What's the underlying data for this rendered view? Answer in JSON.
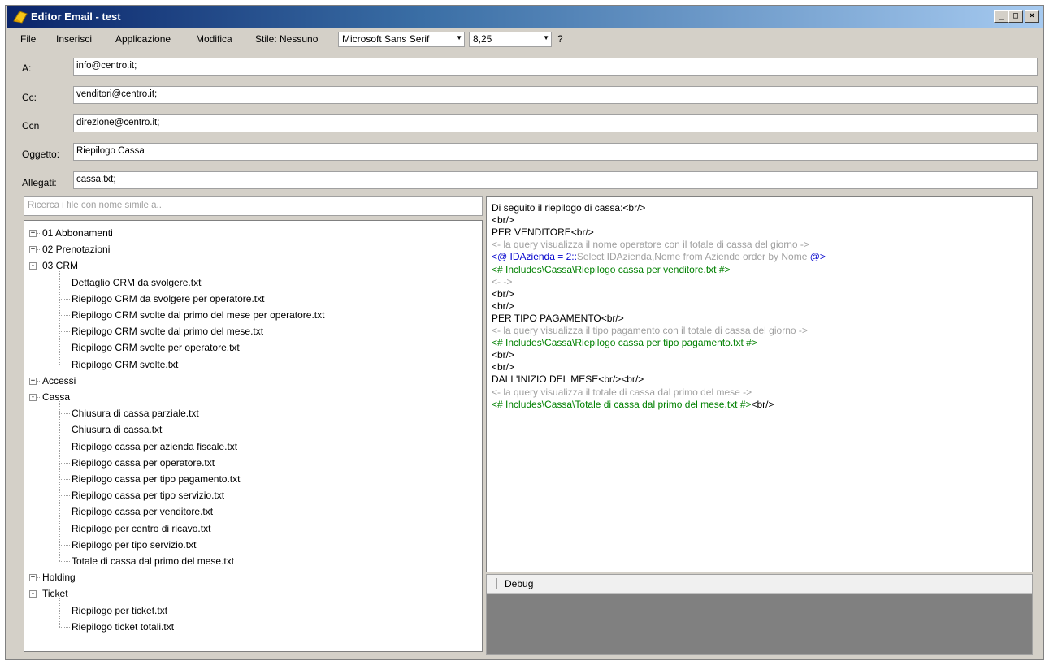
{
  "window": {
    "title": "Editor Email - test",
    "controls": {
      "minimize": "_",
      "maximize": "□",
      "close": "×"
    }
  },
  "menu": {
    "items": [
      "File",
      "Inserisci",
      "Applicazione",
      "Modifica",
      "Stile: Nessuno"
    ],
    "font_name": "Microsoft Sans Serif",
    "font_size": "8,25",
    "help": "?"
  },
  "fields": {
    "to": {
      "label": "A:",
      "value": "info@centro.it;"
    },
    "cc": {
      "label": "Cc:",
      "value": "venditori@centro.it;"
    },
    "bcc": {
      "label": "Ccn",
      "value": "direzione@centro.it;"
    },
    "subject": {
      "label": "Oggetto:",
      "value": "Riepilogo Cassa"
    },
    "attachments": {
      "label": "Allegati:",
      "value": "cassa.txt;"
    }
  },
  "search": {
    "placeholder": "Ricerca i file con nome simile a.."
  },
  "tree": {
    "nodes": [
      {
        "label": "01 Abbonamenti",
        "level": 0,
        "expander": "+"
      },
      {
        "label": "02 Prenotazioni",
        "level": 0,
        "expander": "+"
      },
      {
        "label": "03 CRM",
        "level": 0,
        "expander": "-"
      },
      {
        "label": "Dettaglio CRM da svolgere.txt",
        "level": 1
      },
      {
        "label": "Riepilogo CRM da svolgere per operatore.txt",
        "level": 1
      },
      {
        "label": "Riepilogo CRM svolte dal primo del mese per operatore.txt",
        "level": 1
      },
      {
        "label": "Riepilogo CRM svolte dal primo del mese.txt",
        "level": 1
      },
      {
        "label": "Riepilogo CRM svolte per operatore.txt",
        "level": 1
      },
      {
        "label": "Riepilogo CRM svolte.txt",
        "level": 1
      },
      {
        "label": "Accessi",
        "level": 0,
        "expander": "+"
      },
      {
        "label": "Cassa",
        "level": 0,
        "expander": "-"
      },
      {
        "label": "Chiusura di cassa parziale.txt",
        "level": 1
      },
      {
        "label": "Chiusura di cassa.txt",
        "level": 1
      },
      {
        "label": "Riepilogo cassa per azienda fiscale.txt",
        "level": 1
      },
      {
        "label": "Riepilogo cassa per operatore.txt",
        "level": 1
      },
      {
        "label": "Riepilogo cassa per tipo pagamento.txt",
        "level": 1
      },
      {
        "label": "Riepilogo cassa per tipo servizio.txt",
        "level": 1
      },
      {
        "label": "Riepilogo cassa per venditore.txt",
        "level": 1
      },
      {
        "label": "Riepilogo per centro di ricavo.txt",
        "level": 1
      },
      {
        "label": "Riepilogo per tipo servizio.txt",
        "level": 1
      },
      {
        "label": "Totale di cassa dal primo del mese.txt",
        "level": 1
      },
      {
        "label": "Holding",
        "level": 0,
        "expander": "+"
      },
      {
        "label": "Ticket",
        "level": 0,
        "expander": "-"
      },
      {
        "label": "Riepilogo per ticket.txt",
        "level": 1
      },
      {
        "label": "Riepilogo ticket totali.txt",
        "level": 1
      }
    ]
  },
  "editor": {
    "lines": [
      [
        {
          "t": "Di seguito il riepilogo di cassa:<br/>",
          "c": "black"
        }
      ],
      [
        {
          "t": "<br/>",
          "c": "black"
        }
      ],
      [
        {
          "t": "PER VENDITORE<br/>",
          "c": "black"
        }
      ],
      [
        {
          "t": "<- la query visualizza il nome operatore con il totale di cassa del giorno ->",
          "c": "gray"
        }
      ],
      [
        {
          "t": "<@ ",
          "c": "blue"
        },
        {
          "t": "IDAzienda = 2::",
          "c": "blue"
        },
        {
          "t": "Select IDAzienda,Nome from Aziende order by Nome ",
          "c": "gray"
        },
        {
          "t": "@>",
          "c": "blue"
        }
      ],
      [
        {
          "t": "<# Includes\\Cassa\\Riepilogo cassa per venditore.txt #>",
          "c": "green"
        }
      ],
      [
        {
          "t": "<- ->",
          "c": "gray"
        }
      ],
      [
        {
          "t": "<br/>",
          "c": "black"
        }
      ],
      [
        {
          "t": "<br/>",
          "c": "black"
        }
      ],
      [
        {
          "t": "PER TIPO PAGAMENTO<br/>",
          "c": "black"
        }
      ],
      [
        {
          "t": "<- la query visualizza il tipo pagamento con il totale di cassa del giorno ->",
          "c": "gray"
        }
      ],
      [
        {
          "t": "<# Includes\\Cassa\\Riepilogo cassa per tipo pagamento.txt #>",
          "c": "green"
        }
      ],
      [
        {
          "t": "<br/>",
          "c": "black"
        }
      ],
      [
        {
          "t": "<br/>",
          "c": "black"
        }
      ],
      [
        {
          "t": "DALL'INIZIO DEL MESE<br/><br/>",
          "c": "black"
        }
      ],
      [
        {
          "t": "<- la query visualizza il totale di cassa dal primo del mese ->",
          "c": "gray"
        }
      ],
      [
        {
          "t": "<# Includes\\Cassa\\Totale di cassa dal primo del mese.txt #>",
          "c": "green"
        },
        {
          "t": "<br/>",
          "c": "black"
        }
      ]
    ]
  },
  "debug": {
    "label": "Debug"
  }
}
